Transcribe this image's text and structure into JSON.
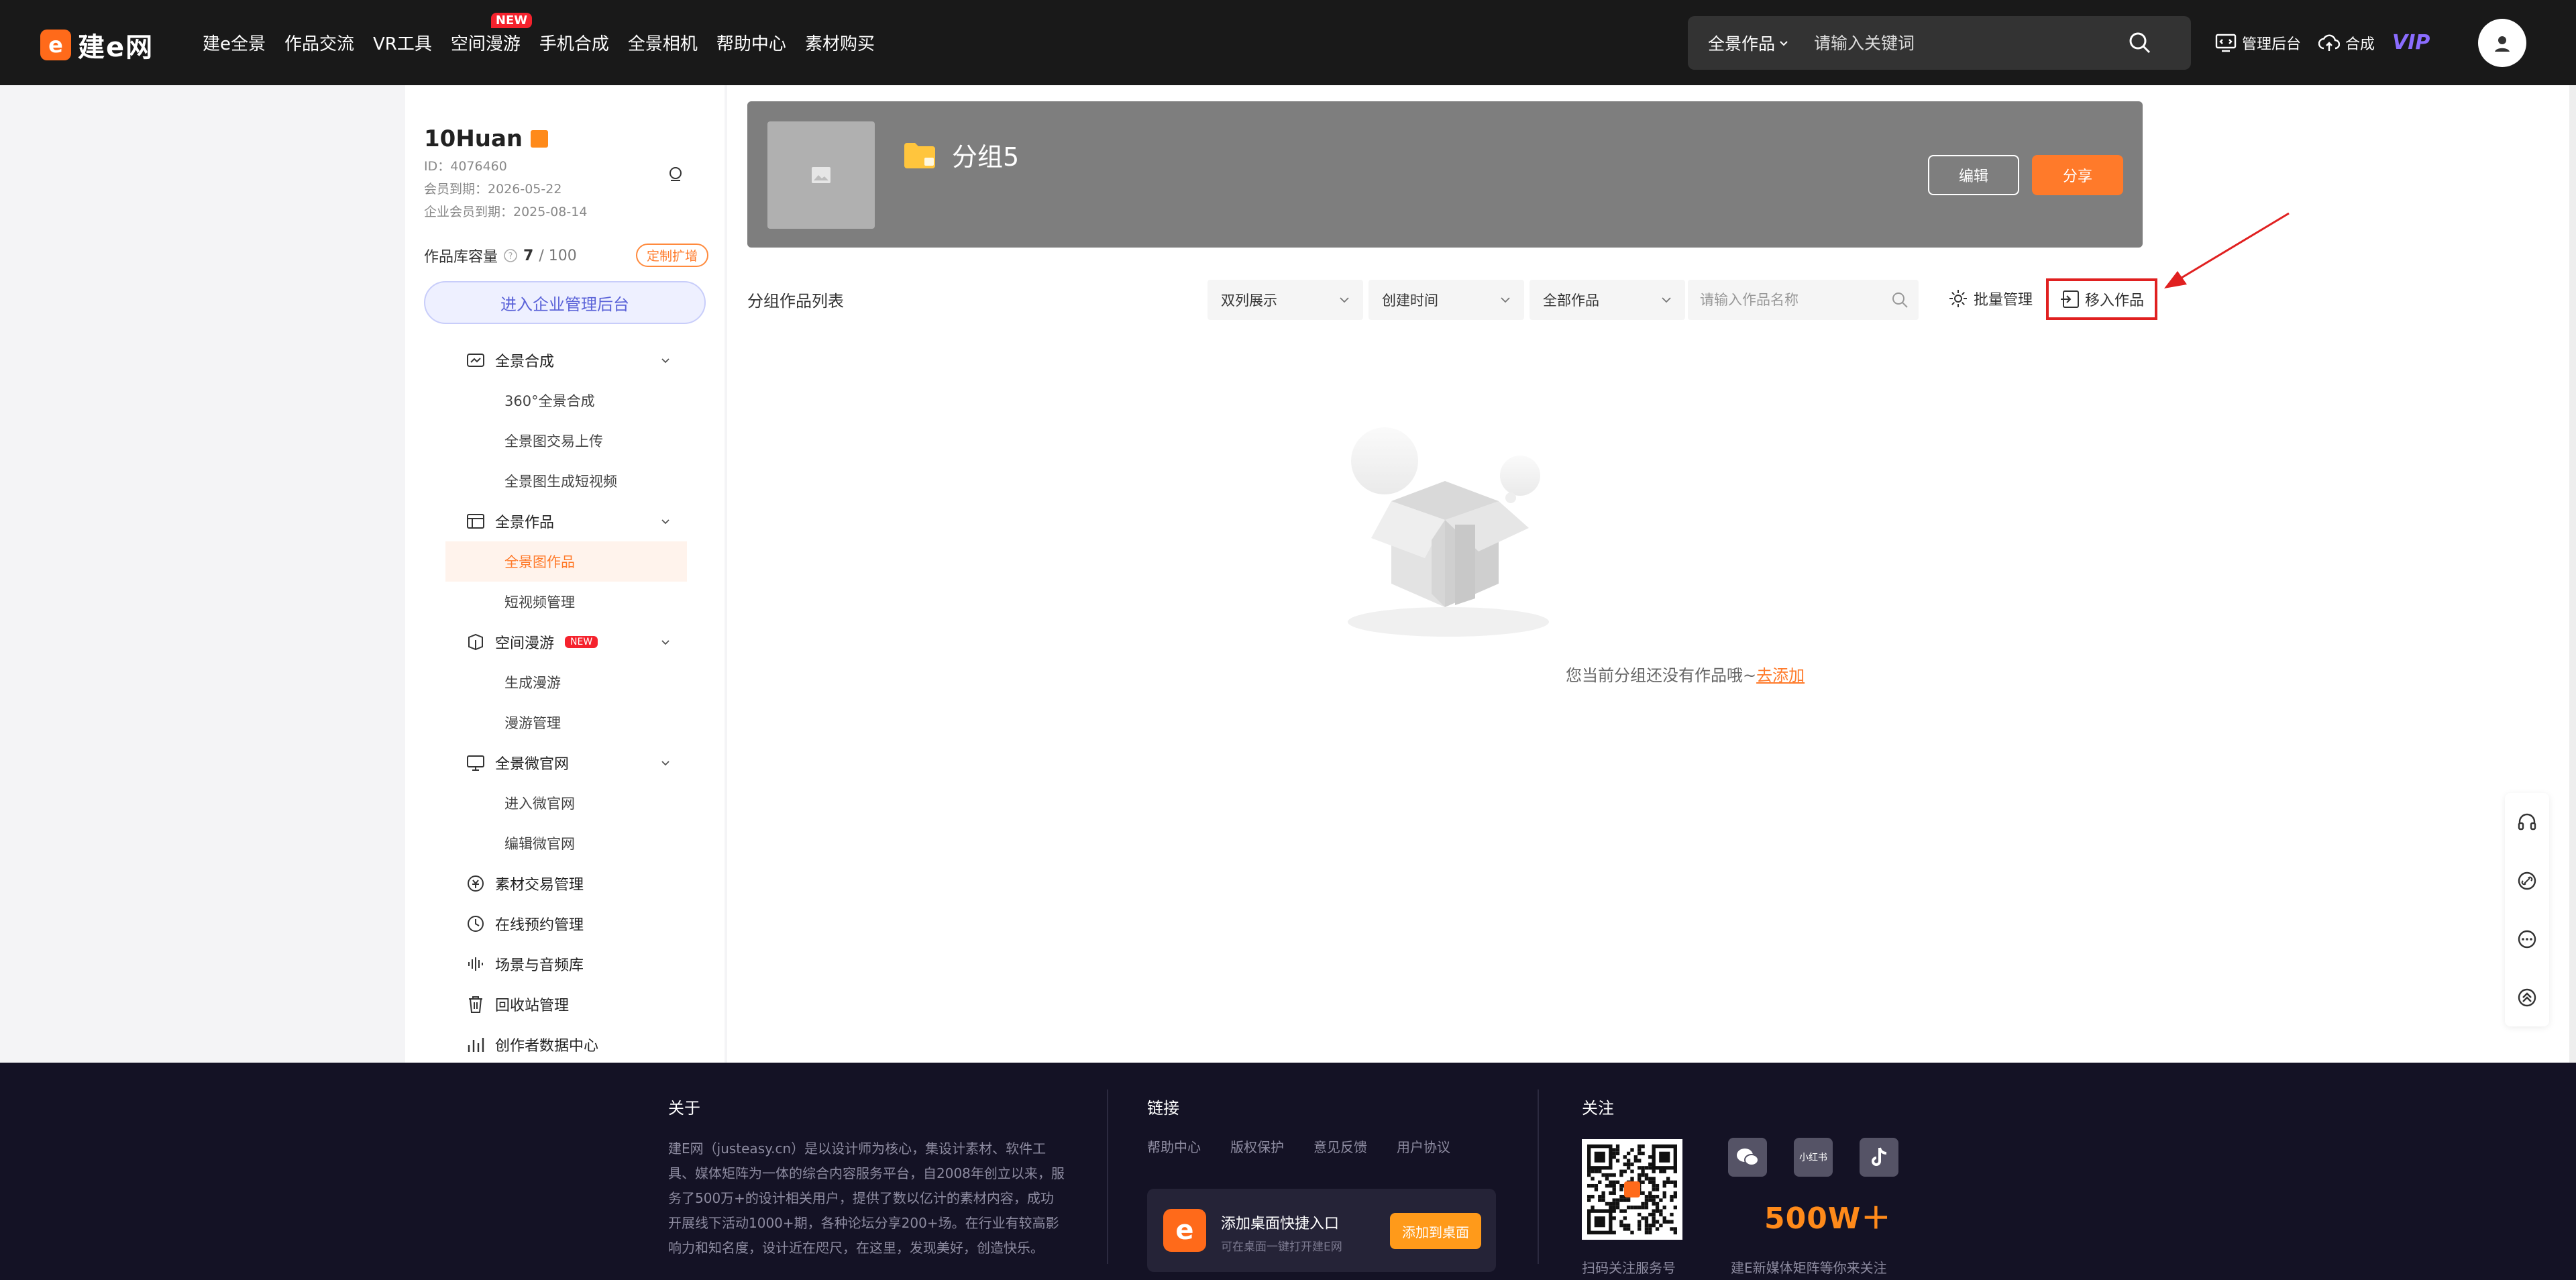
{
  "header": {
    "logo_text": "建e网",
    "logo_mark": "e",
    "nav": [
      {
        "label": "建e全景"
      },
      {
        "label": "作品交流"
      },
      {
        "label": "VR工具"
      },
      {
        "label": "空间漫游",
        "badge": "NEW"
      },
      {
        "label": "手机合成"
      },
      {
        "label": "全景相机"
      },
      {
        "label": "帮助中心"
      },
      {
        "label": "素材购买"
      }
    ],
    "search": {
      "category": "全景作品",
      "placeholder": "请输入关键词"
    },
    "admin_label": "管理后台",
    "compose_label": "合成",
    "vip_label": "VIP"
  },
  "sidebar": {
    "username": "10Huan",
    "id_line": "ID：4076460",
    "member_expiry": "会员到期：2026-05-22",
    "enterprise_expiry": "企业会员到期：2025-08-14",
    "capacity_label": "作品库容量",
    "capacity_used": "7",
    "capacity_total": "/ 100",
    "custom_tag": "定制扩增",
    "enter_button": "进入企业管理后台",
    "menu": [
      {
        "type": "group",
        "label": "全景合成",
        "icon": "compose-icon",
        "expandable": true
      },
      {
        "type": "sub",
        "label": "360°全景合成"
      },
      {
        "type": "sub",
        "label": "全景图交易上传"
      },
      {
        "type": "sub",
        "label": "全景图生成短视频"
      },
      {
        "type": "group",
        "label": "全景作品",
        "icon": "works-icon",
        "expandable": true
      },
      {
        "type": "sub",
        "label": "全景图作品",
        "active": true
      },
      {
        "type": "sub",
        "label": "短视频管理"
      },
      {
        "type": "group",
        "label": "空间漫游",
        "icon": "roam-icon",
        "expandable": true,
        "badge": "NEW"
      },
      {
        "type": "sub",
        "label": "生成漫游"
      },
      {
        "type": "sub",
        "label": "漫游管理"
      },
      {
        "type": "group",
        "label": "全景微官网",
        "icon": "website-icon",
        "expandable": true
      },
      {
        "type": "sub",
        "label": "进入微官网"
      },
      {
        "type": "sub",
        "label": "编辑微官网"
      },
      {
        "type": "group",
        "label": "素材交易管理",
        "icon": "trade-icon"
      },
      {
        "type": "group",
        "label": "在线预约管理",
        "icon": "clock-icon"
      },
      {
        "type": "group",
        "label": "场景与音频库",
        "icon": "audio-icon"
      },
      {
        "type": "group",
        "label": "回收站管理",
        "icon": "trash-icon"
      },
      {
        "type": "group",
        "label": "创作者数据中心",
        "icon": "data-icon"
      }
    ]
  },
  "main": {
    "group_name": "分组5",
    "edit_button": "编辑",
    "share_button": "分享",
    "list_title": "分组作品列表",
    "filters": {
      "display": "双列展示",
      "sort": "创建时间",
      "scope": "全部作品",
      "name_placeholder": "请输入作品名称"
    },
    "batch_label": "批量管理",
    "move_label": "移入作品",
    "empty_text": "您当前分组还没有作品哦~",
    "empty_link": "去添加"
  },
  "footer": {
    "about_title": "关于",
    "about_text": "建E网（justeasy.cn）是以设计师为核心，集设计素材、软件工具、媒体矩阵为一体的综合内容服务平台，自2008年创立以来，服务了500万+的设计相关用户，提供了数以亿计的素材内容，成功开展线下活动1000+期，各种论坛分享200+场。在行业有较高影响力和知名度，设计近在咫尺，在这里，发现美好，创造快乐。",
    "links_title": "链接",
    "links": [
      "帮助中心",
      "版权保护",
      "意见反馈",
      "用户协议"
    ],
    "card_title": "添加桌面快捷入口",
    "card_sub": "可在桌面一键打开建E网",
    "card_button": "添加到桌面",
    "follow_title": "关注",
    "qr_caption": "扫码关注服务号",
    "xhs_label": "小红书",
    "big_number": "500W＋",
    "social_caption": "建E新媒体矩阵等你来关注"
  },
  "colors": {
    "accent": "#ff7a2a",
    "header_bg": "#191919",
    "footer_bg": "#141225",
    "highlight": "#e02020"
  }
}
